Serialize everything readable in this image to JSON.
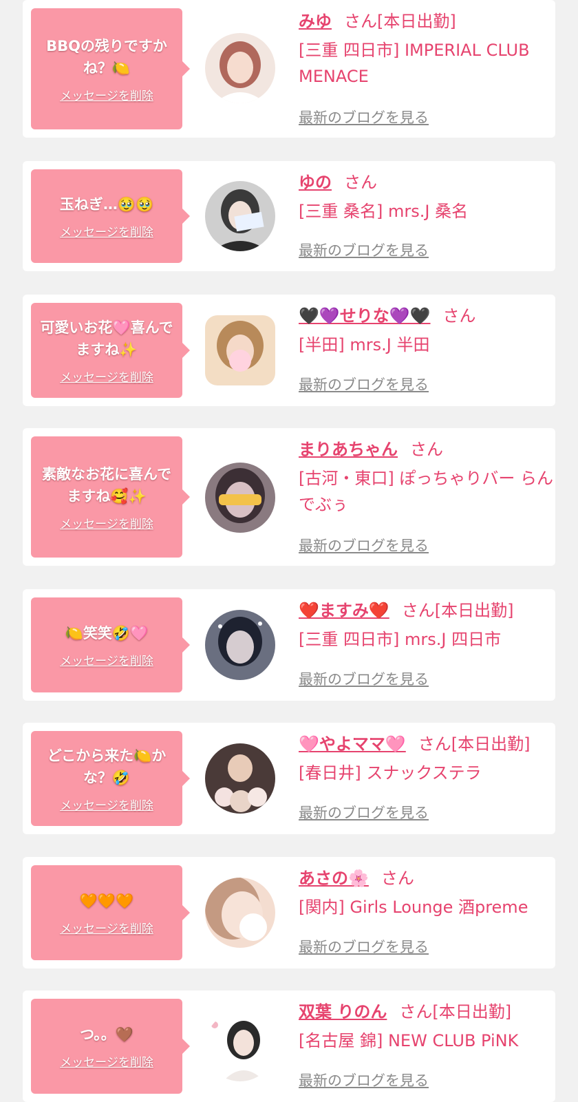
{
  "colors": {
    "page_bg": "#f1f1f1",
    "bubble_bg": "#fa98a6",
    "accent_pink": "#e6436e",
    "link_gray": "#8a8a8a"
  },
  "cards": [
    {
      "message": "BBQの残りですかね？🍋",
      "delete_label": "メッセージを削除",
      "name": "みゆ",
      "suffix": "さん[本日出勤]",
      "shop": "[三重 四日市] IMPERIAL CLUB MENACE",
      "blog_label": "最新のブログを見る",
      "avatar_icon": "woman-photo-icon",
      "avatar_colors": [
        "#f2e6e0",
        "#b0685c"
      ]
    },
    {
      "message": "玉ねぎ…🥹🥹",
      "delete_label": "メッセージを削除",
      "name": "ゆの",
      "suffix": "さん",
      "shop": "[三重 桑名] mrs.J 桑名",
      "blog_label": "最新のブログを見る",
      "avatar_icon": "woman-photo-icon",
      "avatar_colors": [
        "#cfcfcf",
        "#3a3a3a"
      ]
    },
    {
      "message": "可愛いお花🩷喜んでますね✨",
      "delete_label": "メッセージを削除",
      "name": "🖤💜せりな💜🖤",
      "suffix": "さん",
      "shop": "[半田] mrs.J 半田",
      "blog_label": "最新のブログを見る",
      "avatar_icon": "woman-photo-icon",
      "avatar_colors": [
        "#f3ddc4",
        "#b88a5a"
      ]
    },
    {
      "message": "素敵なお花に喜んでますね🥰✨",
      "delete_label": "メッセージを削除",
      "name": "まりあちゃん",
      "suffix": "さん",
      "shop": "[古河・東口] ぽっちゃりバー らんでぶぅ",
      "blog_label": "最新のブログを見る",
      "avatar_icon": "woman-photo-icon",
      "avatar_colors": [
        "#8a7a80",
        "#3c2f35"
      ]
    },
    {
      "message": "🍋笑笑🤣🩷",
      "delete_label": "メッセージを削除",
      "name": "❤️ますみ❤️",
      "suffix": "さん[本日出勤]",
      "shop": "[三重 四日市] mrs.J 四日市",
      "blog_label": "最新のブログを見る",
      "avatar_icon": "woman-photo-icon",
      "avatar_colors": [
        "#6a6f80",
        "#1e2230"
      ]
    },
    {
      "message": "どこから来た🍋かな？🤣",
      "delete_label": "メッセージを削除",
      "name": "🩷やよママ🩷",
      "suffix": "さん[本日出勤]",
      "shop": "[春日井] スナックステラ",
      "blog_label": "最新のブログを見る",
      "avatar_icon": "woman-photo-icon",
      "avatar_colors": [
        "#d9c4b8",
        "#4a3a38"
      ]
    },
    {
      "message": "🧡🧡🧡",
      "delete_label": "メッセージを削除",
      "name": "あさの🌸",
      "suffix": "さん",
      "shop": "[関内] Girls Lounge 酒preme",
      "blog_label": "最新のブログを見る",
      "avatar_icon": "woman-photo-icon",
      "avatar_colors": [
        "#f4ddd0",
        "#c49a82"
      ]
    },
    {
      "message": "つ。。🤎",
      "delete_label": "メッセージを削除",
      "name": "双葉 りのん",
      "suffix": "さん[本日出勤]",
      "shop": "[名古屋 錦] NEW CLUB PiNK",
      "blog_label": "最新のブログを見る",
      "avatar_icon": "woman-photo-icon",
      "avatar_colors": [
        "#ffffff",
        "#2a2a2a"
      ]
    }
  ]
}
